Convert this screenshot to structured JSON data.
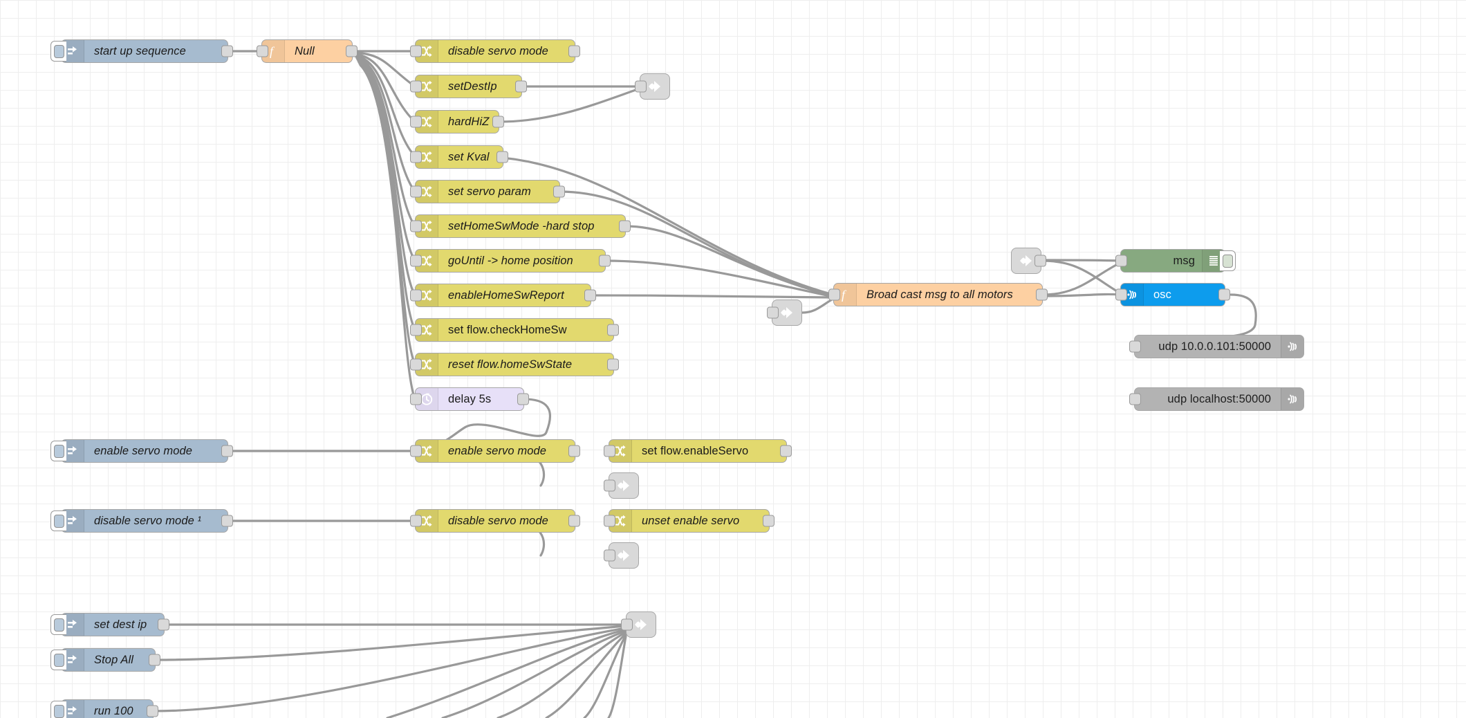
{
  "app": {
    "name": "Node-RED flow editor canvas",
    "background": "#ffffff",
    "grid_color": "#e4e4e4",
    "wire_color": "#999999"
  },
  "palette": {
    "inject": "#a6bbcf",
    "function": "#fdd0a2",
    "change": "#e2d96e",
    "delay": "#e7e0f8",
    "debug": "#87a980",
    "osc": "#0d9ced",
    "udp": "#b3b3b3",
    "link": "#d9d9d9"
  },
  "nodes": {
    "inject_startup": {
      "label": "start up sequence",
      "icon": "inject-arrow-icon",
      "type": "inject"
    },
    "func_null": {
      "label": "Null",
      "icon": "function-f-icon",
      "type": "function"
    },
    "chg_disable_servo": {
      "label": "disable servo mode",
      "icon": "change-swap-icon",
      "type": "change"
    },
    "chg_setdestip": {
      "label": "setDestIp",
      "icon": "change-swap-icon",
      "type": "change"
    },
    "chg_hardhiz": {
      "label": "hardHiZ",
      "icon": "change-swap-icon",
      "type": "change"
    },
    "chg_setkval": {
      "label": "set Kval",
      "icon": "change-swap-icon",
      "type": "change"
    },
    "chg_servoparam": {
      "label": "set servo param",
      "icon": "change-swap-icon",
      "type": "change"
    },
    "chg_homeswmode": {
      "label": "setHomeSwMode -hard stop",
      "icon": "change-swap-icon",
      "type": "change"
    },
    "chg_gountil": {
      "label": "goUntil -> home position",
      "icon": "change-swap-icon",
      "type": "change"
    },
    "chg_enablehomesw": {
      "label": "enableHomeSwReport",
      "icon": "change-swap-icon",
      "type": "change"
    },
    "chg_checkhomesw": {
      "label": "set flow.checkHomeSw",
      "icon": "change-swap-icon",
      "type": "change"
    },
    "chg_resethomesw": {
      "label": "reset flow.homeSwState",
      "icon": "change-swap-icon",
      "type": "change"
    },
    "delay_5s": {
      "label": "delay 5s",
      "icon": "clock-icon",
      "type": "delay"
    },
    "func_broadcast": {
      "label": "Broad cast msg to all motors",
      "icon": "function-f-icon",
      "type": "function"
    },
    "debug_msg": {
      "label": "msg",
      "icon": "debug-lines-icon",
      "type": "debug"
    },
    "osc_node": {
      "label": "osc",
      "icon": "osc-wave-icon",
      "type": "osc"
    },
    "udp_remote": {
      "label": "udp 10.0.0.101:50000",
      "icon": "udp-wave-icon",
      "type": "udp"
    },
    "udp_local": {
      "label": "udp localhost:50000",
      "icon": "udp-wave-icon",
      "type": "udp"
    },
    "inject_enable_servo": {
      "label": "enable servo mode",
      "icon": "inject-arrow-icon",
      "type": "inject"
    },
    "chg_enable_servo": {
      "label": "enable servo mode",
      "icon": "change-swap-icon",
      "type": "change"
    },
    "chg_set_enableservo": {
      "label": "set flow.enableServo",
      "icon": "change-swap-icon",
      "type": "change"
    },
    "inject_disable_servo": {
      "label": "disable servo mode ¹",
      "icon": "inject-arrow-icon",
      "type": "inject"
    },
    "chg_disable_servo_2": {
      "label": "disable servo mode",
      "icon": "change-swap-icon",
      "type": "change"
    },
    "chg_unset_enableservo": {
      "label": "unset enable servo",
      "icon": "change-swap-icon",
      "type": "change"
    },
    "inject_setdestip": {
      "label": "set dest ip",
      "icon": "inject-arrow-icon",
      "type": "inject"
    },
    "inject_stopall": {
      "label": "Stop All",
      "icon": "inject-arrow-icon",
      "type": "inject"
    },
    "inject_run100": {
      "label": "run 100",
      "icon": "inject-arrow-icon",
      "type": "inject"
    },
    "link_out_1": {
      "label": "",
      "icon": "link-out-icon",
      "type": "link"
    },
    "link_out_2": {
      "label": "",
      "icon": "link-out-icon",
      "type": "link"
    },
    "link_out_3": {
      "label": "",
      "icon": "link-out-icon",
      "type": "link"
    },
    "link_out_4": {
      "label": "",
      "icon": "link-out-icon",
      "type": "link"
    },
    "link_out_5": {
      "label": "",
      "icon": "link-out-icon",
      "type": "link"
    },
    "link_out_6": {
      "label": "",
      "icon": "link-out-icon",
      "type": "link"
    }
  }
}
